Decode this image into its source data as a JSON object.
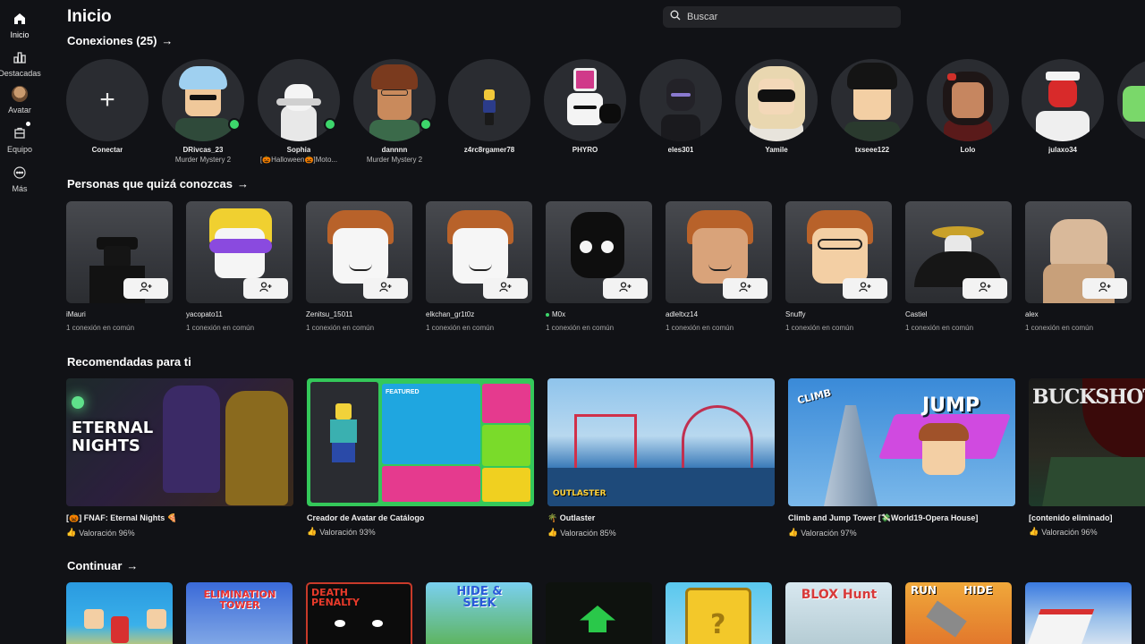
{
  "sidebar": {
    "items": [
      {
        "label": "Inicio",
        "icon": "home-icon"
      },
      {
        "label": "Destacadas",
        "icon": "charts-icon"
      },
      {
        "label": "Avatar",
        "icon": "avatar-icon"
      },
      {
        "label": "Equipo",
        "icon": "team-icon"
      },
      {
        "label": "Más",
        "icon": "more-icon"
      }
    ]
  },
  "header": {
    "title": "Inicio",
    "search_placeholder": "Buscar"
  },
  "connections": {
    "title": "Conexiones (25)",
    "connect_label": "Conectar",
    "items": [
      {
        "name": "DRivcas_23",
        "sub": "Murder Mystery 2",
        "online": true
      },
      {
        "name": "Sophia",
        "sub": "[🎃Halloween🎃]Moto...",
        "online": true
      },
      {
        "name": "dannnn",
        "sub": "Murder Mystery 2",
        "online": true
      },
      {
        "name": "z4rc8rgamer78",
        "sub": "",
        "online": false
      },
      {
        "name": "PHYRO",
        "sub": "",
        "online": false
      },
      {
        "name": "eles301",
        "sub": "",
        "online": false
      },
      {
        "name": "Yamile",
        "sub": "",
        "online": false
      },
      {
        "name": "txseee122",
        "sub": "",
        "online": false
      },
      {
        "name": "Lolo",
        "sub": "",
        "online": false
      },
      {
        "name": "julaxo34",
        "sub": "",
        "online": false
      }
    ]
  },
  "people": {
    "title": "Personas que quizá conozcas",
    "items": [
      {
        "name": "iMauri",
        "mutual": "1 conexión en común",
        "online": false
      },
      {
        "name": "yacopato11",
        "mutual": "1 conexión en común",
        "online": false
      },
      {
        "name": "Zenitsu_15011",
        "mutual": "1 conexión en común",
        "online": false
      },
      {
        "name": "elkchan_gr1t0z",
        "mutual": "1 conexión en común",
        "online": false
      },
      {
        "name": "M0x",
        "mutual": "1 conexión en común",
        "online": true
      },
      {
        "name": "adleltxz14",
        "mutual": "1 conexión en común",
        "online": false
      },
      {
        "name": "Snuffy",
        "mutual": "1 conexión en común",
        "online": false
      },
      {
        "name": "Castiel",
        "mutual": "1 conexión en común",
        "online": false
      },
      {
        "name": "alex",
        "mutual": "1 conexión en común",
        "online": false
      }
    ]
  },
  "recommended": {
    "title": "Recomendadas para ti",
    "items": [
      {
        "name": "[🎃] FNAF: Eternal Nights 🍕",
        "rating": "Valoración 96%",
        "thumb_text": "ETERNAL NIGHTS"
      },
      {
        "name": "Creador de Avatar de Catálogo",
        "rating": "Valoración 93%",
        "thumb_text": "FEATURED"
      },
      {
        "name": "🌴 Outlaster",
        "rating": "Valoración 85%",
        "thumb_text": "OUTLASTER"
      },
      {
        "name": "Climb and Jump Tower [💸World19-Opera House]",
        "rating": "Valoración 97%",
        "thumb_text": "JUMP"
      },
      {
        "name": "[contenido eliminado]",
        "rating": "Valoración 96%",
        "thumb_text": "BUCKSHOT"
      }
    ]
  },
  "continue": {
    "title": "Continuar",
    "items": [
      {
        "label": ""
      },
      {
        "label": "ELIMINATION TOWER"
      },
      {
        "label": "DEATH PENALTY"
      },
      {
        "label": "HIDE & SEEK"
      },
      {
        "label": ""
      },
      {
        "label": ""
      },
      {
        "label": "BLOX Hunt"
      },
      {
        "label": "RUN HIDE"
      },
      {
        "label": ""
      }
    ]
  },
  "colors": {
    "background": "#111216",
    "online": "#3dd66b",
    "card": "#2a2c31"
  }
}
